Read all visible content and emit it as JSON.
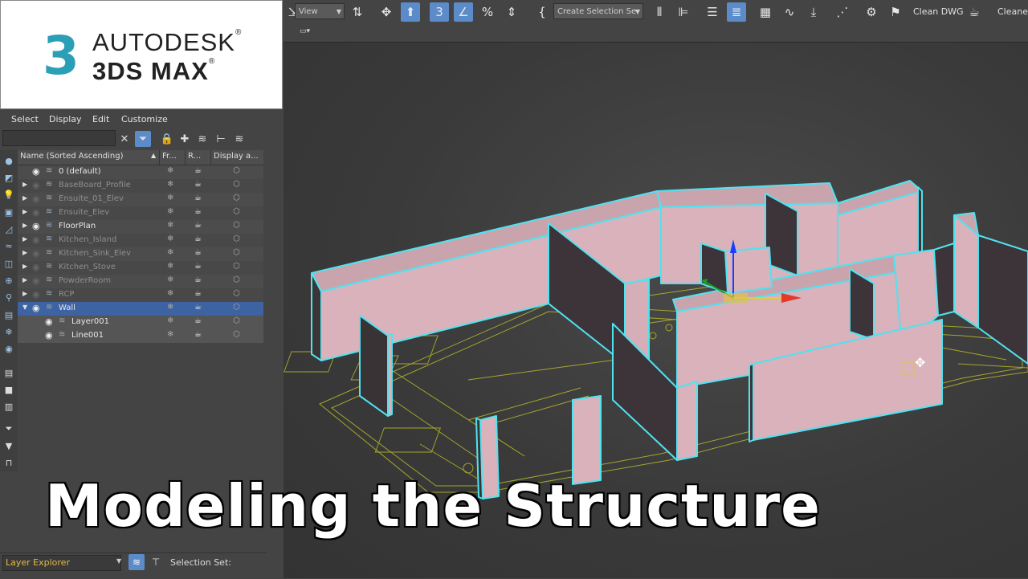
{
  "logo": {
    "line1": "AUTODESK",
    "line2": "3DS MAX",
    "mark": "3",
    "reg": "®"
  },
  "toolbar": {
    "view_combo": "View",
    "selection_set_combo": "Create Selection Se",
    "clean_dwg_label": "Clean DWG",
    "cleaner_label": "Cleaner",
    "icons": [
      "select-and-link-icon",
      "move-icon",
      "select-object-icon",
      "snap-3d-icon",
      "angle-snap-icon",
      "percent-snap-icon",
      "spinner-snap-icon",
      "edit-named-selection-icon",
      "mirror-icon",
      "align-icon",
      "toggle-scene-explorer-icon",
      "toggle-layer-explorer-icon",
      "toggle-ribbon-icon",
      "curve-editor-icon",
      "render-setup-icon",
      "schematic-view-icon",
      "teapot-icon"
    ]
  },
  "layer_explorer": {
    "menu": [
      "Select",
      "Display",
      "Edit",
      "Customize"
    ],
    "columns": {
      "name": "Name (Sorted Ascending)",
      "frozen": "Fr...",
      "render": "R...",
      "display": "Display a..."
    },
    "layers": [
      {
        "name": "0 (default)",
        "dim": false,
        "expander": "",
        "visible": true
      },
      {
        "name": "BaseBoard_Profile",
        "dim": true,
        "expander": "▶",
        "visible": false
      },
      {
        "name": "Ensuite_01_Elev",
        "dim": true,
        "expander": "▶",
        "visible": false
      },
      {
        "name": "Ensuite_Elev",
        "dim": true,
        "expander": "▶",
        "visible": false
      },
      {
        "name": "FloorPlan",
        "dim": false,
        "expander": "▶",
        "visible": true
      },
      {
        "name": "Kitchen_Island",
        "dim": true,
        "expander": "▶",
        "visible": false
      },
      {
        "name": "Kitchen_Sink_Elev",
        "dim": true,
        "expander": "▶",
        "visible": false
      },
      {
        "name": "Kitchen_Stove",
        "dim": true,
        "expander": "▶",
        "visible": false
      },
      {
        "name": "PowderRoom",
        "dim": true,
        "expander": "▶",
        "visible": false
      },
      {
        "name": "RCP",
        "dim": true,
        "expander": "▶",
        "visible": false
      },
      {
        "name": "Wall",
        "dim": false,
        "expander": "▼",
        "visible": true,
        "selected": true
      },
      {
        "name": "Layer001",
        "dim": false,
        "expander": "",
        "visible": true,
        "child": true
      },
      {
        "name": "Line001",
        "dim": false,
        "expander": "",
        "visible": true,
        "child": true
      }
    ]
  },
  "bottom": {
    "explorer_combo": "Layer Explorer",
    "selection_set_label": "Selection Set:"
  },
  "title_overlay": "Modeling the Structure",
  "colors": {
    "wall_fill": "#d9b2bc",
    "wall_outline": "#4fe3f0",
    "floorplan": "#c8c830",
    "selection_blue": "#3d63a3"
  }
}
